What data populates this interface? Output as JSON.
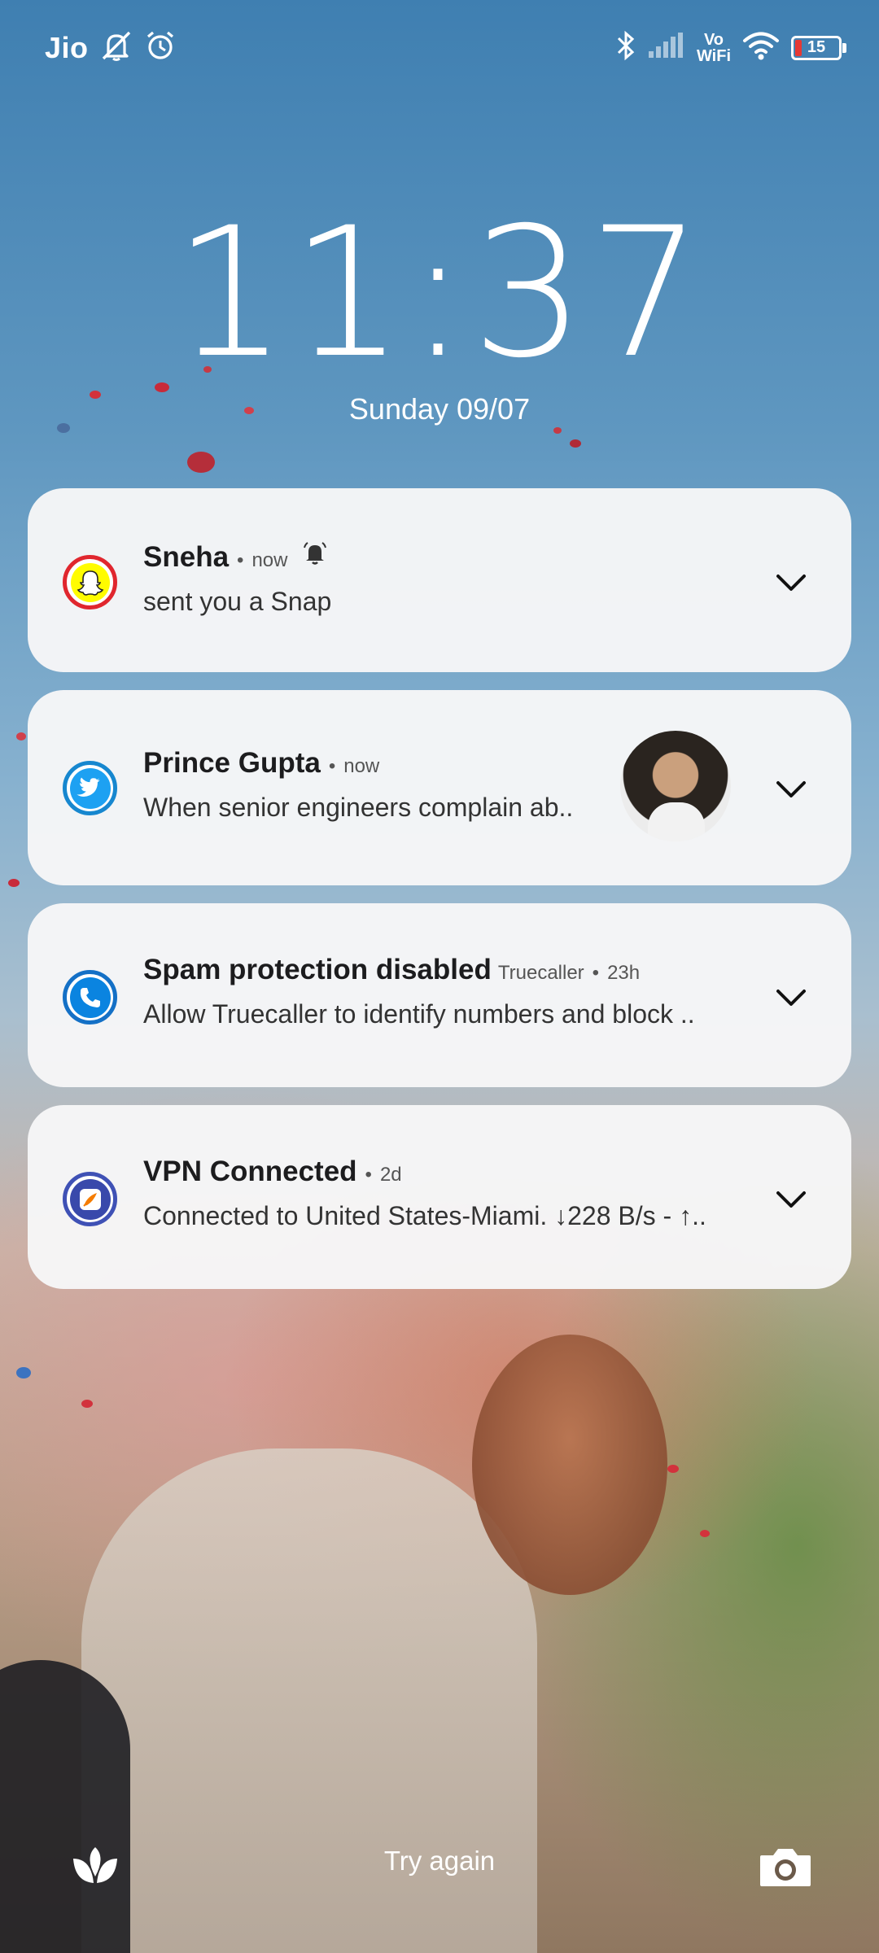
{
  "status_bar": {
    "carrier": "Jio",
    "volte_top": "Vo",
    "volte_bottom": "WiFi",
    "battery_level": "15",
    "battery_percent": 15,
    "icons": [
      "mute-icon",
      "alarm-icon",
      "bluetooth-icon",
      "signal-icon",
      "wifi-icon",
      "battery-icon"
    ]
  },
  "lockscreen": {
    "time": "11:37",
    "date": "Sunday 09/07"
  },
  "notifications": [
    {
      "app": "Snapchat",
      "icon": "snapchat-icon",
      "title": "Sneha",
      "time": "now",
      "body": "sent you a Snap",
      "has_bell": true,
      "accent": "#FFFC00"
    },
    {
      "app": "Twitter",
      "icon": "twitter-icon",
      "title": "Prince Gupta",
      "time": "now",
      "body": "When senior engineers complain ab..",
      "has_avatar": true,
      "accent": "#1DA1F2"
    },
    {
      "app": "Truecaller",
      "icon": "truecaller-icon",
      "title": "Spam protection disabled",
      "source": "Truecaller",
      "time": "23h",
      "body": "Allow Truecaller to identify numbers and block ..",
      "accent": "#0087FF"
    },
    {
      "app": "VPN",
      "icon": "vpn-icon",
      "title": "VPN Connected",
      "time": "2d",
      "body": "Connected to United States-Miami. ↓228 B/s - ↑..",
      "accent": "#3F51B5"
    }
  ],
  "bottom_bar": {
    "left_icon": "wallpaper-carousel-icon",
    "center_text": "Try again",
    "right_icon": "camera-icon"
  }
}
